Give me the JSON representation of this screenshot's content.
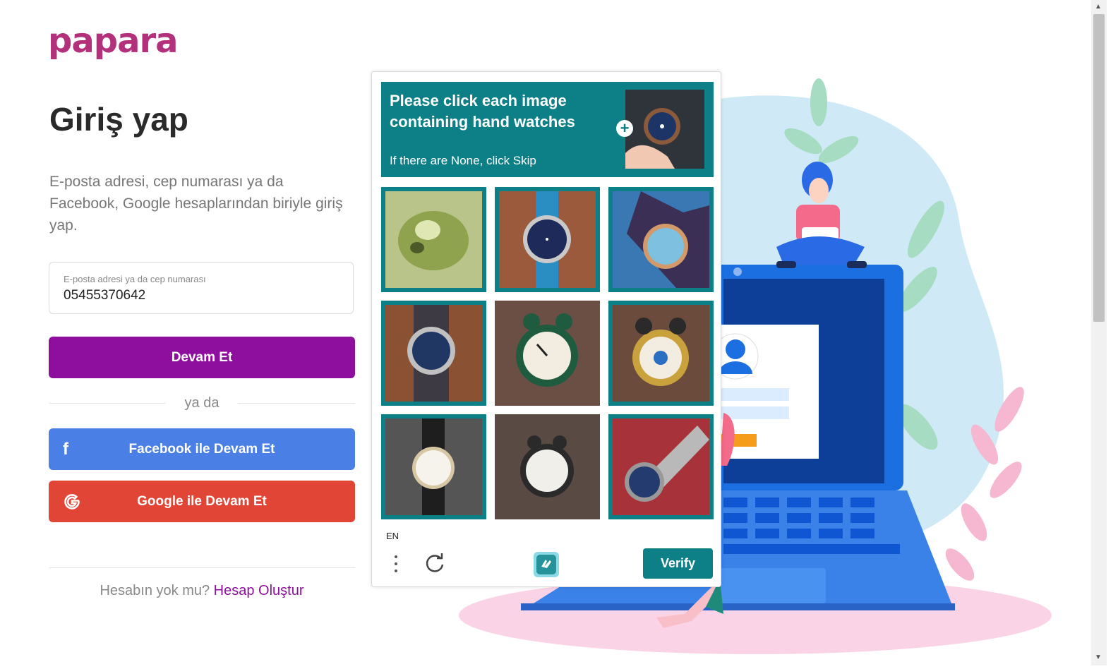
{
  "brand": {
    "logo_text": "papara"
  },
  "login": {
    "title": "Giriş yap",
    "subtitle": "E-posta adresi, cep numarası ya da Facebook, Google hesaplarından biriyle giriş yap.",
    "field_label": "E-posta adresi ya da cep numarası",
    "field_value": "05455370642",
    "continue_label": "Devam Et",
    "divider_text": "ya da",
    "facebook_label": "Facebook ile Devam Et",
    "google_label": "Google ile Devam Et",
    "footer_question": "Hesabın yok mu?",
    "footer_link": "Hesap Oluştur"
  },
  "captcha": {
    "prompt": "Please click each image containing hand watches",
    "skip_hint": "If there are None, click Skip",
    "language": "EN",
    "verify_label": "Verify",
    "tiles": [
      {
        "content": "blurry-green-object",
        "selected_frame": true
      },
      {
        "content": "wrist-watch-blue-strap",
        "selected_frame": true
      },
      {
        "content": "wrist-watch-on-blue",
        "selected_frame": true
      },
      {
        "content": "wrist-watch-on-wood",
        "selected_frame": true
      },
      {
        "content": "green-alarm-clock",
        "selected_frame": false
      },
      {
        "content": "yellow-alarm-clock",
        "selected_frame": true
      },
      {
        "content": "leather-wrist-watch",
        "selected_frame": true
      },
      {
        "content": "black-alarm-clock",
        "selected_frame": false
      },
      {
        "content": "metal-wrist-watch-red",
        "selected_frame": true
      }
    ]
  },
  "colors": {
    "brand_purple": "#8e0f9e",
    "facebook_blue": "#4a7fe6",
    "google_red": "#e04535",
    "captcha_teal": "#0d7f86"
  }
}
